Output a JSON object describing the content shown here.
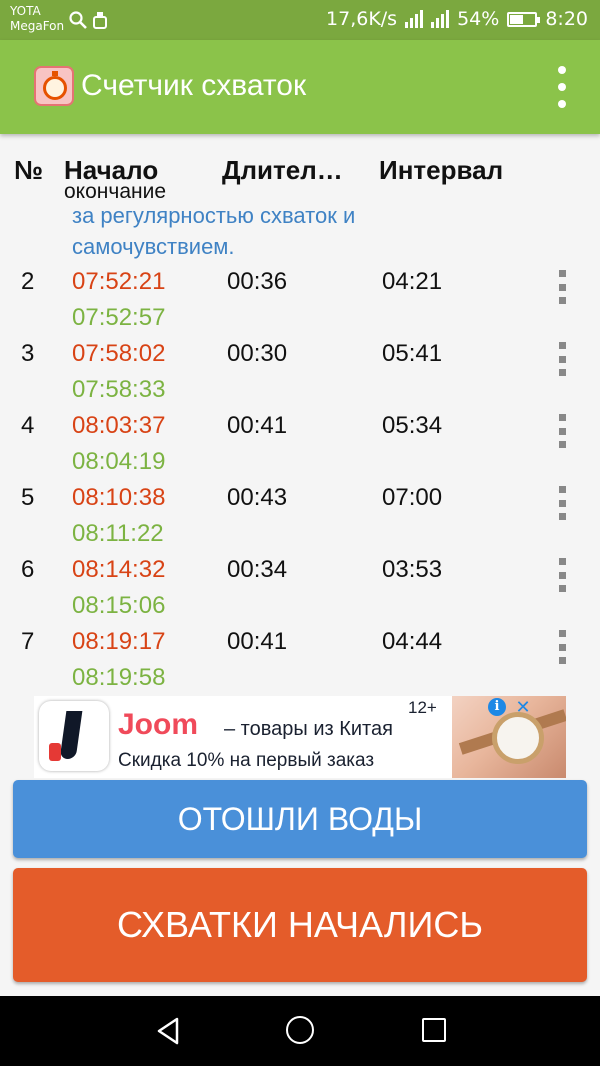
{
  "status_bar": {
    "carrier_1": "YOTA",
    "carrier_2": "MegaFon",
    "left_icons": [
      "search-icon",
      "usb-icon"
    ],
    "speed": "17,6K/s",
    "battery_percent": "54%",
    "battery_level": 0.54,
    "time": "8:20"
  },
  "app_bar": {
    "title": "Счетчик схваток",
    "icon": "stopwatch-icon",
    "menu_icon": "overflow-menu-icon"
  },
  "table": {
    "headers": {
      "num": "№",
      "start": "Начало",
      "start_sub": "окончание",
      "duration": "Длител…",
      "interval": "Интервал"
    },
    "banner_text": "за регулярностью схваток и самочувствием.",
    "rows": [
      {
        "num": "2",
        "start": "07:52:21",
        "end": "07:52:57",
        "duration": "00:36",
        "interval": "04:21"
      },
      {
        "num": "3",
        "start": "07:58:02",
        "end": "07:58:33",
        "duration": "00:30",
        "interval": "05:41"
      },
      {
        "num": "4",
        "start": "08:03:37",
        "end": "08:04:19",
        "duration": "00:41",
        "interval": "05:34"
      },
      {
        "num": "5",
        "start": "08:10:38",
        "end": "08:11:22",
        "duration": "00:43",
        "interval": "07:00"
      },
      {
        "num": "6",
        "start": "08:14:32",
        "end": "08:15:06",
        "duration": "00:34",
        "interval": "03:53"
      },
      {
        "num": "7",
        "start": "08:19:17",
        "end": "08:19:58",
        "duration": "00:41",
        "interval": "04:44"
      }
    ]
  },
  "ad": {
    "brand": "Joom",
    "line1": "– товары из Китая",
    "line2": "Скидка 10% на первый заказ",
    "age": "12+"
  },
  "buttons": {
    "water": "ОТОШЛИ ВОДЫ",
    "start": "СХВАТКИ НАЧАЛИСЬ"
  },
  "colors": {
    "status_bar": "#7ba83f",
    "app_bar": "#8bc34a",
    "start_time": "#d84315",
    "end_time": "#7cb342",
    "water_button": "#4a90d9",
    "start_button": "#e45c2a"
  }
}
